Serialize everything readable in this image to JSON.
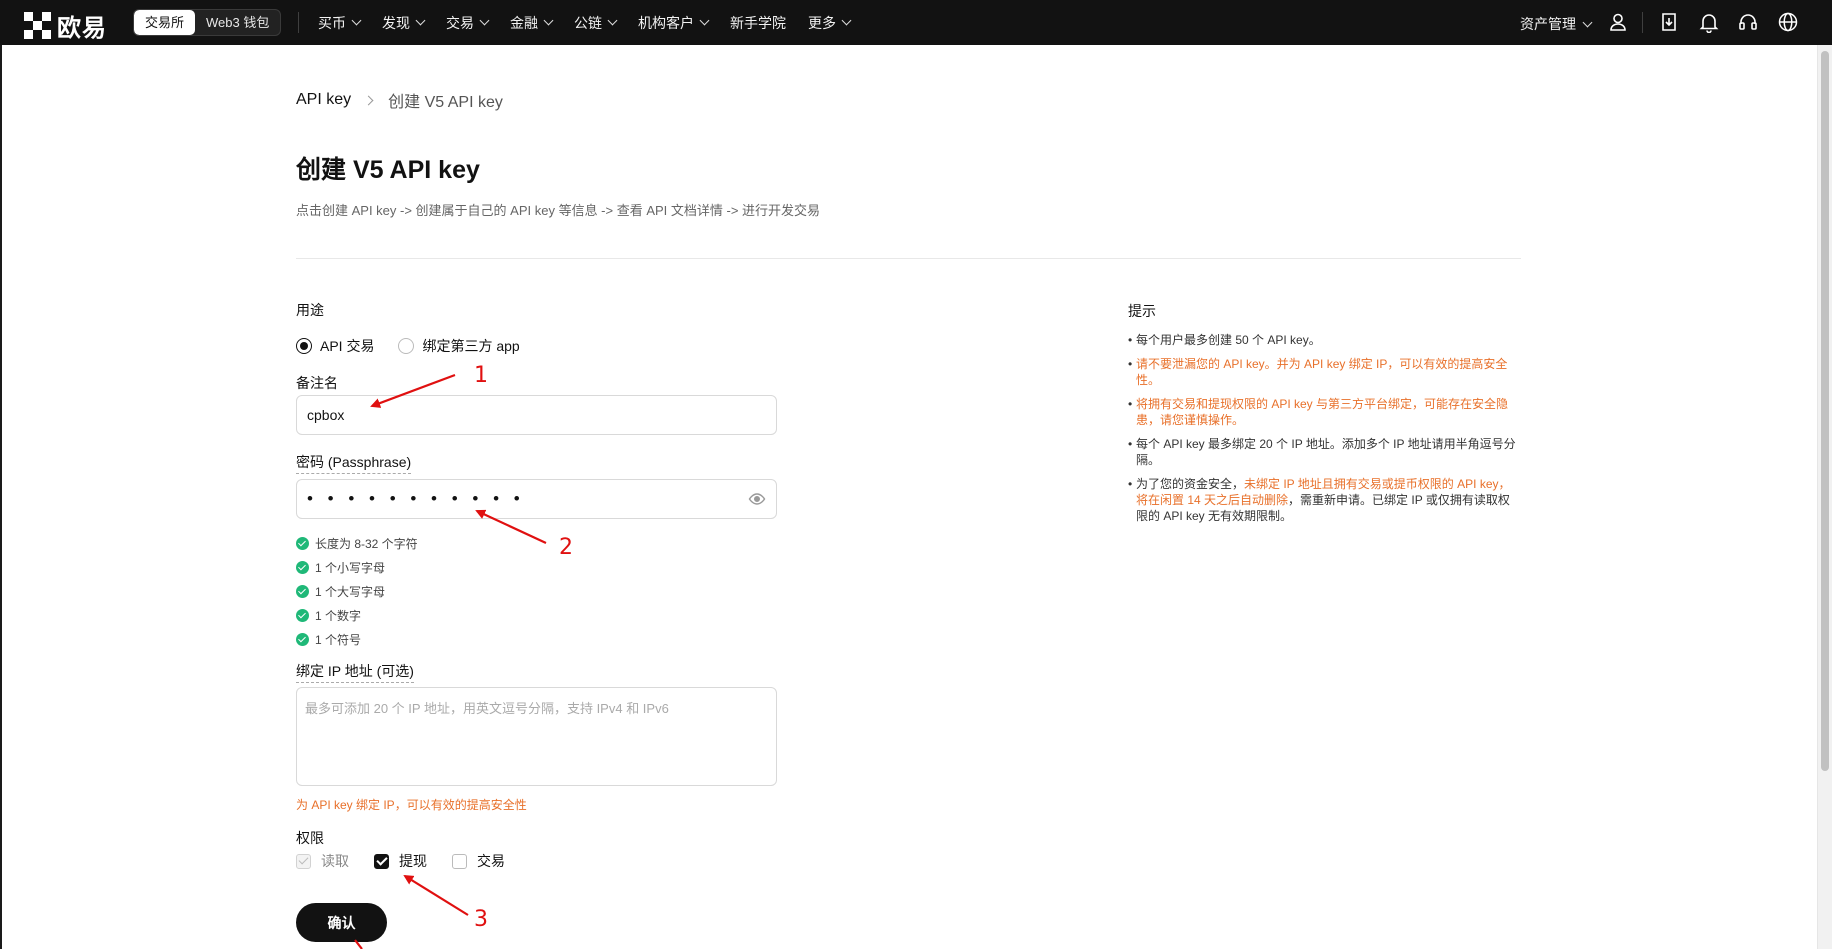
{
  "nav": {
    "logo_text": "欧易",
    "mode_exchange": "交易所",
    "mode_wallet": "Web3 钱包",
    "menu": [
      "买币",
      "发现",
      "交易",
      "金融",
      "公链",
      "机构客户",
      "新手学院",
      "更多"
    ],
    "menu_has_chevron": [
      true,
      true,
      true,
      true,
      true,
      true,
      false,
      true
    ],
    "asset_label": "资产管理",
    "icons": [
      "user-icon",
      "download-icon",
      "bell-icon",
      "headset-icon",
      "globe-icon"
    ]
  },
  "breadcrumb": {
    "root": "API key",
    "current": "创建 V5 API key"
  },
  "page": {
    "title": "创建 V5 API key",
    "subtitle": "点击创建 API key -> 创建属于自己的 API key 等信息 -> 查看 API 文档详情 -> 进行开发交易"
  },
  "form": {
    "purpose_label": "用途",
    "purpose_options": [
      "API 交易",
      "绑定第三方 app"
    ],
    "purpose_selected": "API 交易",
    "name_label": "备注名",
    "name_value": "cpbox",
    "password_label": "密码 (Passphrase)",
    "password_value": "• • • • • • • • • • •",
    "password_rules": [
      "长度为 8-32 个字符",
      "1 个小写字母",
      "1 个大写字母",
      "1 个数字",
      "1 个符号"
    ],
    "ip_label": "绑定 IP 地址 (可选)",
    "ip_placeholder": "最多可添加 20 个 IP 地址，用英文逗号分隔，支持 IPv4 和 IPv6",
    "ip_hint": "为 API key 绑定 IP，可以有效的提高安全性",
    "permissions_label": "权限",
    "permissions": [
      {
        "label": "读取",
        "checked": true,
        "disabled": true
      },
      {
        "label": "提现",
        "checked": true,
        "disabled": false
      },
      {
        "label": "交易",
        "checked": false,
        "disabled": false
      }
    ],
    "confirm_label": "确认"
  },
  "tips": {
    "title": "提示",
    "t1": "每个用户最多创建 50 个 API key。",
    "t2": "请不要泄漏您的 API key。并为 API key 绑定 IP，可以有效的提高安全性。",
    "t3": "将拥有交易和提现权限的 API key 与第三方平台绑定，可能存在安全隐患，请您谨慎操作。",
    "t4": "每个 API key 最多绑定 20 个 IP 地址。添加多个 IP 地址请用半角逗号分隔。",
    "t5_a": "为了您的资金安全，",
    "t5_b": "未绑定 IP 地址且拥有交易或提币权限的 API key，将在闲置 14 天之后自动删除",
    "t5_c": "，需重新申请。已绑定 IP 或仅拥有读取权限的 API key 无有效期限制。"
  },
  "annotations": {
    "n1": "1",
    "n2": "2",
    "n3": "3"
  },
  "colors": {
    "accent_warn": "#e8702a",
    "success": "#1fb878",
    "annotation": "#e01010",
    "nav_bg": "#121212"
  }
}
